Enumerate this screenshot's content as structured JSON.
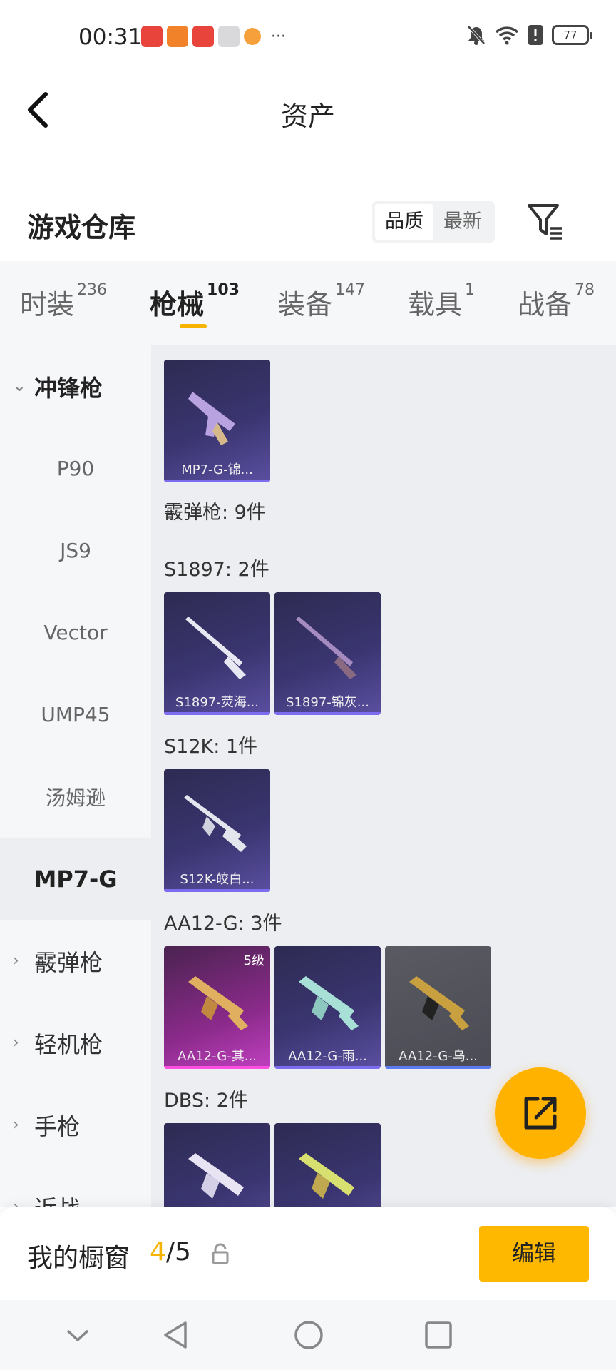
{
  "status_bar": {
    "time": "00:31",
    "more_indicator": "···",
    "battery": "77",
    "icons": [
      "huawei-app-notif-icon",
      "orange-app-notif-icon",
      "huawei-app-notif-icon",
      "gift-notif-icon",
      "pet-notif-icon",
      "mute-icon",
      "wifi-icon",
      "alert-icon",
      "battery-icon"
    ]
  },
  "header": {
    "title": "资产",
    "back_icon": "back-arrow-icon"
  },
  "warehouse": {
    "title": "游戏仓库",
    "sort_options": [
      "品质",
      "最新"
    ],
    "sort_selected": "品质",
    "filter_icon": "filter-icon"
  },
  "tabs": [
    {
      "label": "时装",
      "count": "236"
    },
    {
      "label": "枪械",
      "count": "103"
    },
    {
      "label": "装备",
      "count": "147"
    },
    {
      "label": "载具",
      "count": "1"
    },
    {
      "label": "战备",
      "count": "78"
    }
  ],
  "active_tab": "枪械",
  "sidebar": {
    "groups": [
      {
        "label": "冲锋枪",
        "expanded": true
      },
      {
        "label": "霰弹枪"
      },
      {
        "label": "轻机枪"
      },
      {
        "label": "手枪"
      },
      {
        "label": "近战"
      }
    ],
    "subitems": [
      "P90",
      "JS9",
      "Vector",
      "UMP45",
      "汤姆逊",
      "MP7-G"
    ],
    "active_subitem": "MP7-G"
  },
  "content": {
    "mp7_card": {
      "name": "MP7-G-锦..."
    },
    "shotgun_summary": "霰弹枪: 9件",
    "s1897": {
      "label": "S1897: 2件",
      "cards": [
        "S1897-荧海...",
        "S1897-锦灰..."
      ]
    },
    "s12k": {
      "label": "S12K: 1件",
      "cards": [
        "S12K-皎白..."
      ]
    },
    "aa12": {
      "label": "AA12-G: 3件",
      "cards": [
        "AA12-G-其...",
        "AA12-G-雨...",
        "AA12-G-乌..."
      ],
      "level_badge": "5级"
    },
    "dbs": {
      "label": "DBS: 2件"
    }
  },
  "fab_icon": "share-export-icon",
  "showcase": {
    "title": "我的橱窗",
    "current": "4",
    "separator": "/",
    "total": "5",
    "lock_icon": "lock-icon",
    "edit_label": "编辑"
  },
  "navbar": {
    "icons": [
      "collapse-chevron-icon",
      "back-triangle-icon",
      "home-circle-icon",
      "recents-square-icon"
    ]
  },
  "colors": {
    "accent": "#f6b400",
    "card_purple": "#3a3570",
    "card_pink": "#c040c0",
    "card_gray": "#4b4b55"
  }
}
